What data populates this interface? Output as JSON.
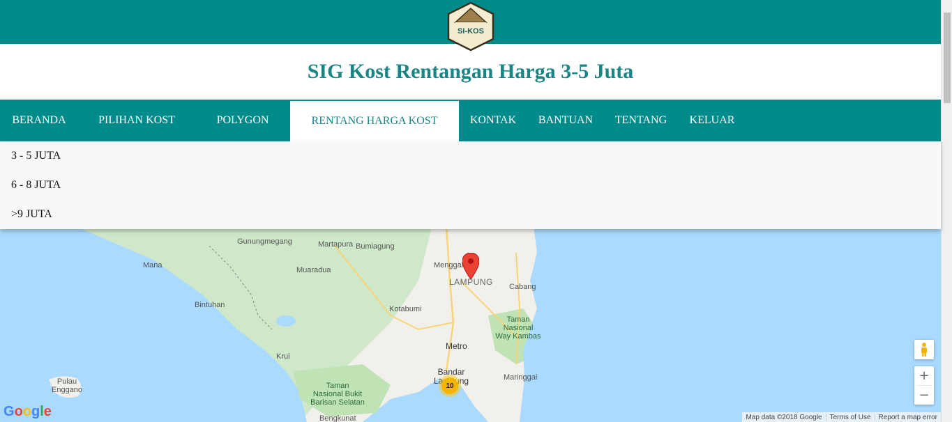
{
  "header": {
    "logo_text": "SI-KOS",
    "title": "SIG Kost Rentangan Harga 3-5 Juta"
  },
  "nav": {
    "items": [
      {
        "label": "BERANDA"
      },
      {
        "label": "PILIHAN KOST"
      },
      {
        "label": "POLYGON"
      },
      {
        "label": "RENTANG HARGA KOST",
        "active": true
      },
      {
        "label": "KONTAK"
      },
      {
        "label": "BANTUAN"
      },
      {
        "label": "TENTANG"
      },
      {
        "label": "KELUAR"
      }
    ]
  },
  "dropdown": {
    "options": [
      "3 - 5 JUTA",
      "6 - 8 JUTA",
      ">9 JUTA"
    ]
  },
  "map": {
    "places": {
      "gunungmegang": "Gunungmegang",
      "martapura": "Martapura",
      "bumiagung": "Bumiagung",
      "mana": "Mana",
      "muaradua": "Muaradua",
      "menggala": "Menggala",
      "lampung": "LAMPUNG",
      "cabang": "Cabang",
      "bintuhan": "Bintuhan",
      "kotabumi": "Kotabumi",
      "taman_way_kambas_1": "Taman",
      "taman_way_kambas_2": "Nasional",
      "taman_way_kambas_3": "Way Kambas",
      "metro": "Metro",
      "krui": "Krui",
      "bandar_1": "Bandar",
      "bandar_2": "Lampung",
      "maringgai": "Maringgai",
      "pulau_1": "Pulau",
      "pulau_2": "Enggano",
      "taman_bukit_1": "Taman",
      "taman_bukit_2": "Nasional Bukit",
      "taman_bukit_3": "Barisan Selatan",
      "bengkunat": "Bengkunat"
    },
    "cluster_count": "10",
    "zoom_in": "+",
    "zoom_out": "−",
    "google": "Google",
    "attribution": {
      "data": "Map data ©2018 Google",
      "terms": "Terms of Use",
      "report": "Report a map error"
    }
  },
  "colors": {
    "primary": "#008b8b",
    "title": "#1a8585",
    "marker": "#ea4335",
    "cluster": "#f4b400"
  }
}
